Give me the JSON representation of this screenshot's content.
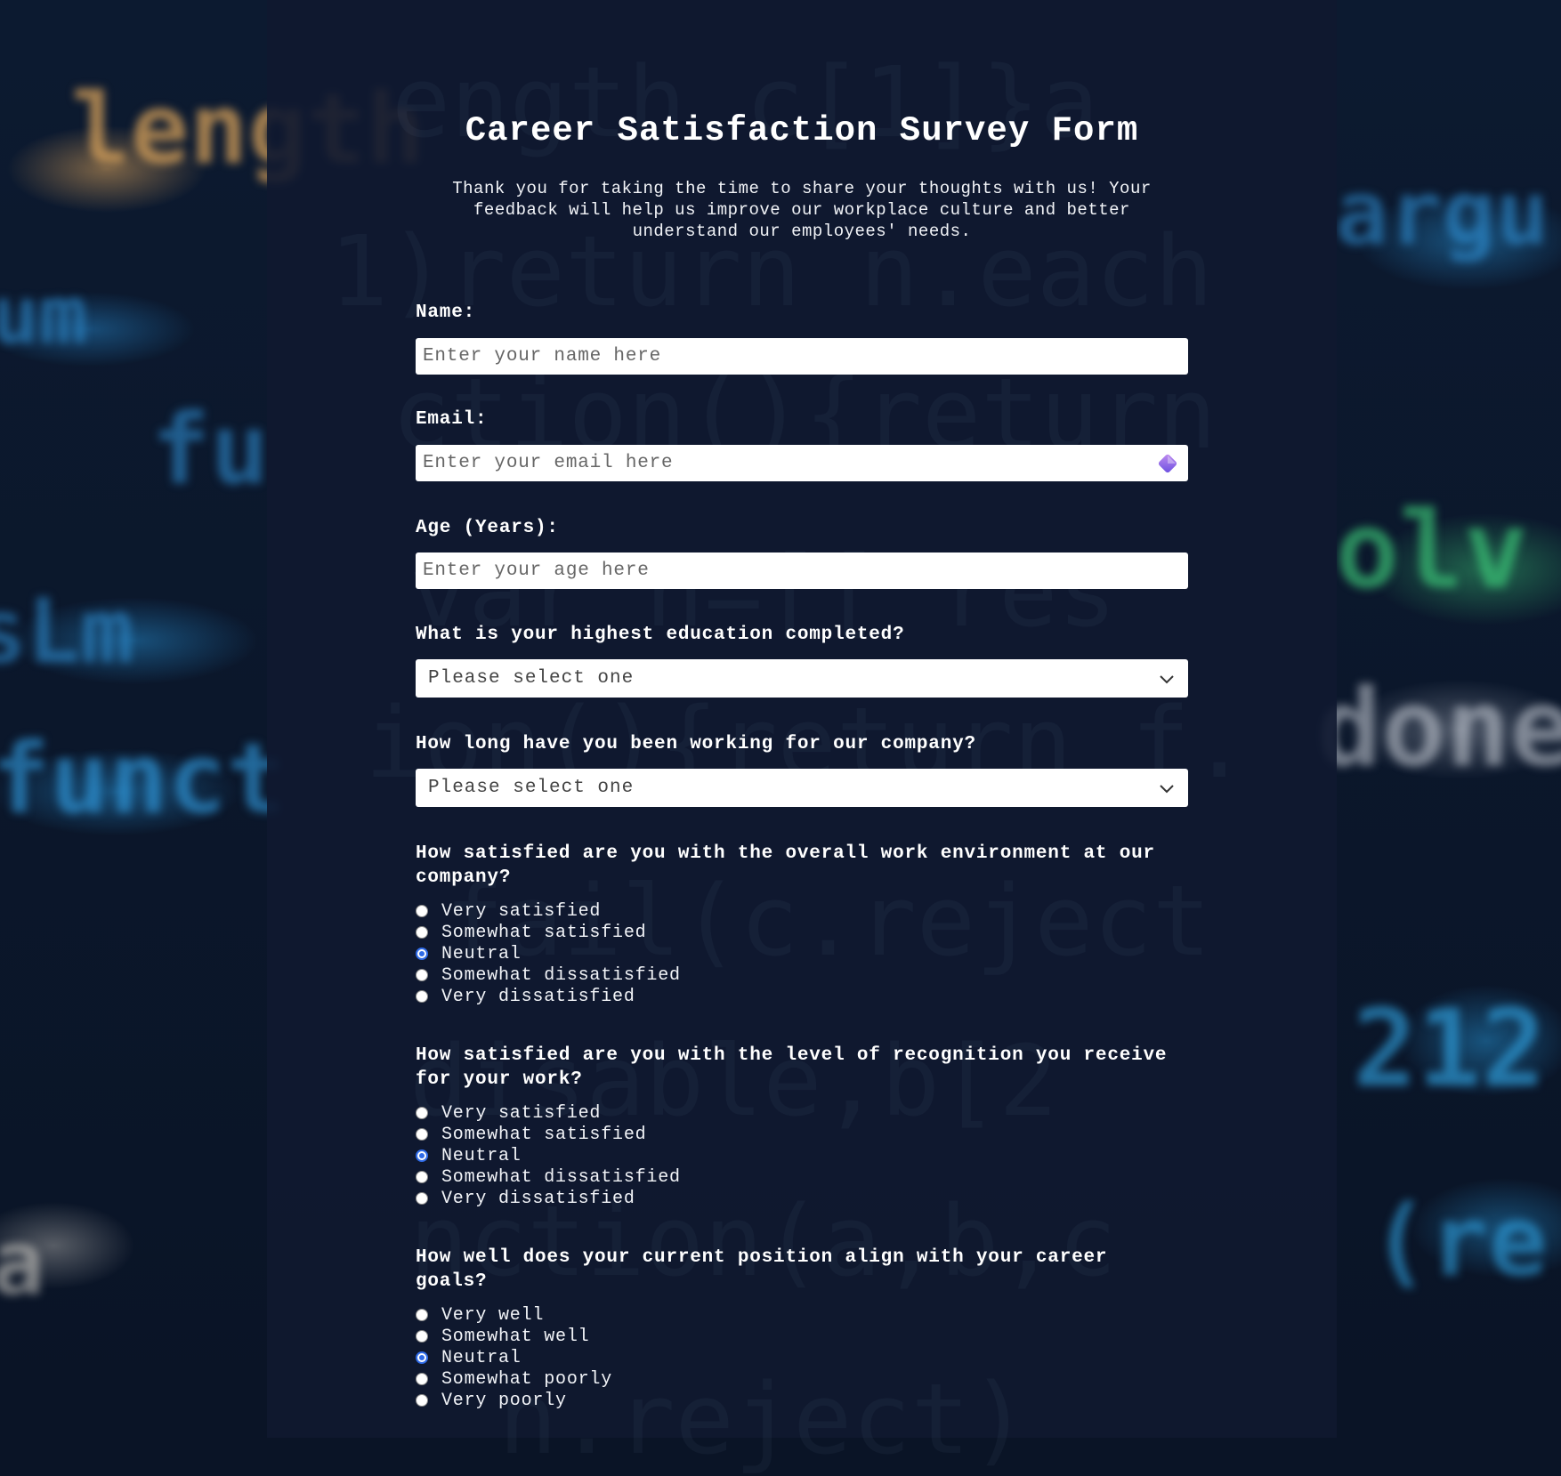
{
  "form": {
    "title": "Career Satisfaction Survey Form",
    "intro": "Thank you for taking the time to share your thoughts with us! Your feedback will help us improve our workplace culture and better understand our employees' needs.",
    "name_label": "Name:",
    "name_placeholder": "Enter your name here",
    "email_label": "Email:",
    "email_placeholder": "Enter your email here",
    "age_label": "Age (Years):",
    "age_placeholder": "Enter your age here",
    "education_label": "What is your highest education completed?",
    "education_value": "Please select one",
    "tenure_label": "How long have you been working for our company?",
    "tenure_value": "Please select one",
    "q_environment": {
      "question": "How satisfied are you with the overall work environment at our company?",
      "options": [
        "Very satisfied",
        "Somewhat satisfied",
        "Neutral",
        "Somewhat dissatisfied",
        "Very dissatisfied"
      ],
      "selected": "Neutral"
    },
    "q_recognition": {
      "question": "How satisfied are you with the level of recognition you receive for your work?",
      "options": [
        "Very satisfied",
        "Somewhat satisfied",
        "Neutral",
        "Somewhat dissatisfied",
        "Very dissatisfied"
      ],
      "selected": "Neutral"
    },
    "q_alignment": {
      "question": "How well does your current position align with your career goals?",
      "options": [
        "Very well",
        "Somewhat well",
        "Neutral",
        "Somewhat poorly",
        "Very poorly"
      ],
      "selected": "Neutral"
    }
  },
  "colors": {
    "accent": "#2f6be8",
    "panel": "#101830",
    "text": "#ffffff"
  },
  "icons": {
    "email_field_icon": "password-manager-icon",
    "select_icon": "chevron-down-icon"
  }
}
